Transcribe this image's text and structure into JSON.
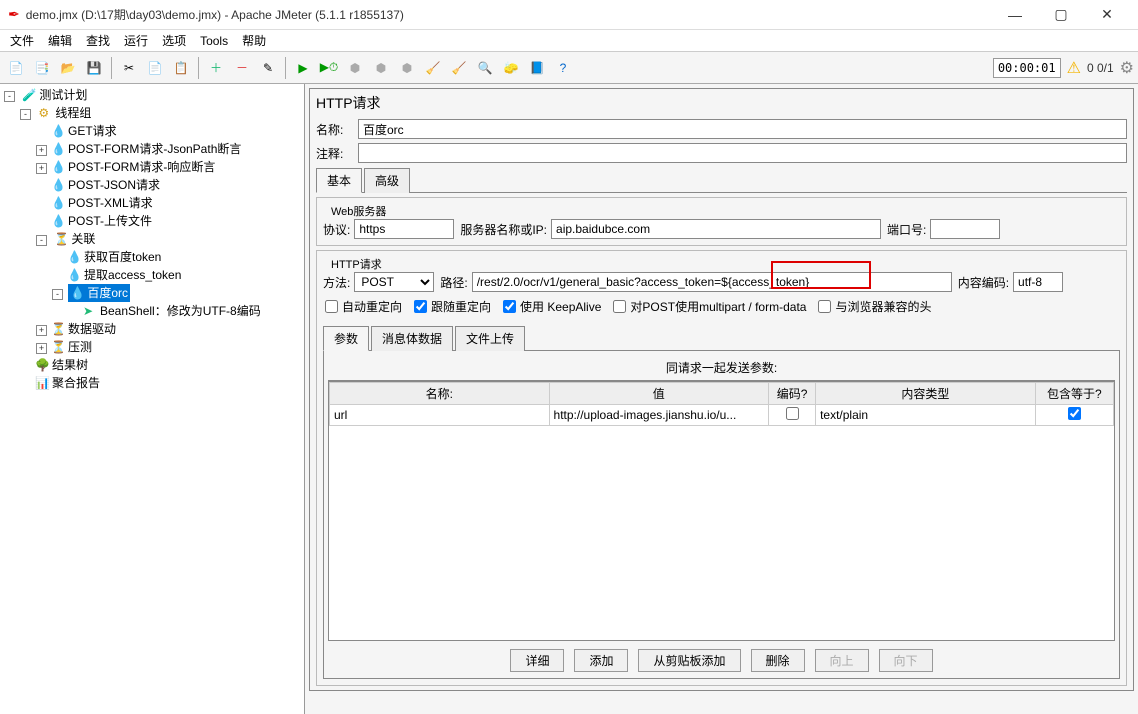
{
  "window": {
    "title": "demo.jmx (D:\\17期\\day03\\demo.jmx) - Apache JMeter (5.1.1 r1855137)"
  },
  "menu": {
    "file": "文件",
    "edit": "编辑",
    "search": "查找",
    "run": "运行",
    "options": "选项",
    "tools": "Tools",
    "help": "帮助"
  },
  "toolbar": {
    "timer": "00:00:01",
    "counter": "0  0/1"
  },
  "tree": {
    "root": "测试计划",
    "threadgroup": "线程组",
    "items": {
      "get": "GET请求",
      "postform_json": "POST-FORM请求-JsonPath断言",
      "postform_resp": "POST-FORM请求-响应断言",
      "postjson": "POST-JSON请求",
      "postxml": "POST-XML请求",
      "postupload": "POST-上传文件",
      "corr": "关联",
      "corr1": "获取百度token",
      "corr2": "提取access_token",
      "corr3": "百度orc",
      "corr3a": "BeanShell：修改为UTF-8编码",
      "datadrive": "数据驱动",
      "yace": "压测"
    },
    "resulttree": "结果树",
    "aggreport": "聚合报告"
  },
  "http": {
    "paneltitle": "HTTP请求",
    "name_label": "名称:",
    "name_value": "百度orc",
    "comment_label": "注释:",
    "comment_value": "",
    "tab_basic": "基本",
    "tab_adv": "高级",
    "webserver_legend": "Web服务器",
    "protocol_label": "协议:",
    "protocol_value": "https",
    "server_label": "服务器名称或IP:",
    "server_value": "aip.baidubce.com",
    "port_label": "端口号:",
    "port_value": "",
    "request_legend": "HTTP请求",
    "method_label": "方法:",
    "method_value": "POST",
    "path_label": "路径:",
    "path_value": "/rest/2.0/ocr/v1/general_basic?access_token=${access_token}",
    "encoding_label": "内容编码:",
    "encoding_value": "utf-8",
    "check_autoredirect": "自动重定向",
    "check_followredirect": "跟随重定向",
    "check_keepalive": "使用 KeepAlive",
    "check_multipart": "对POST使用multipart / form-data",
    "check_browser": "与浏览器兼容的头",
    "innertab_params": "参数",
    "innertab_body": "消息体数据",
    "innertab_files": "文件上传",
    "params_title": "同请求一起发送参数:",
    "cols": {
      "name": "名称:",
      "value": "值",
      "encode": "编码?",
      "ctype": "内容类型",
      "include": "包含等于?"
    },
    "rows": [
      {
        "name": "url",
        "value": "http://upload-images.jianshu.io/u...",
        "encode": false,
        "ctype": "text/plain",
        "include": true
      }
    ],
    "btns": {
      "detail": "详细",
      "add": "添加",
      "clip": "从剪贴板添加",
      "delete": "删除",
      "up": "向上",
      "down": "向下"
    }
  }
}
